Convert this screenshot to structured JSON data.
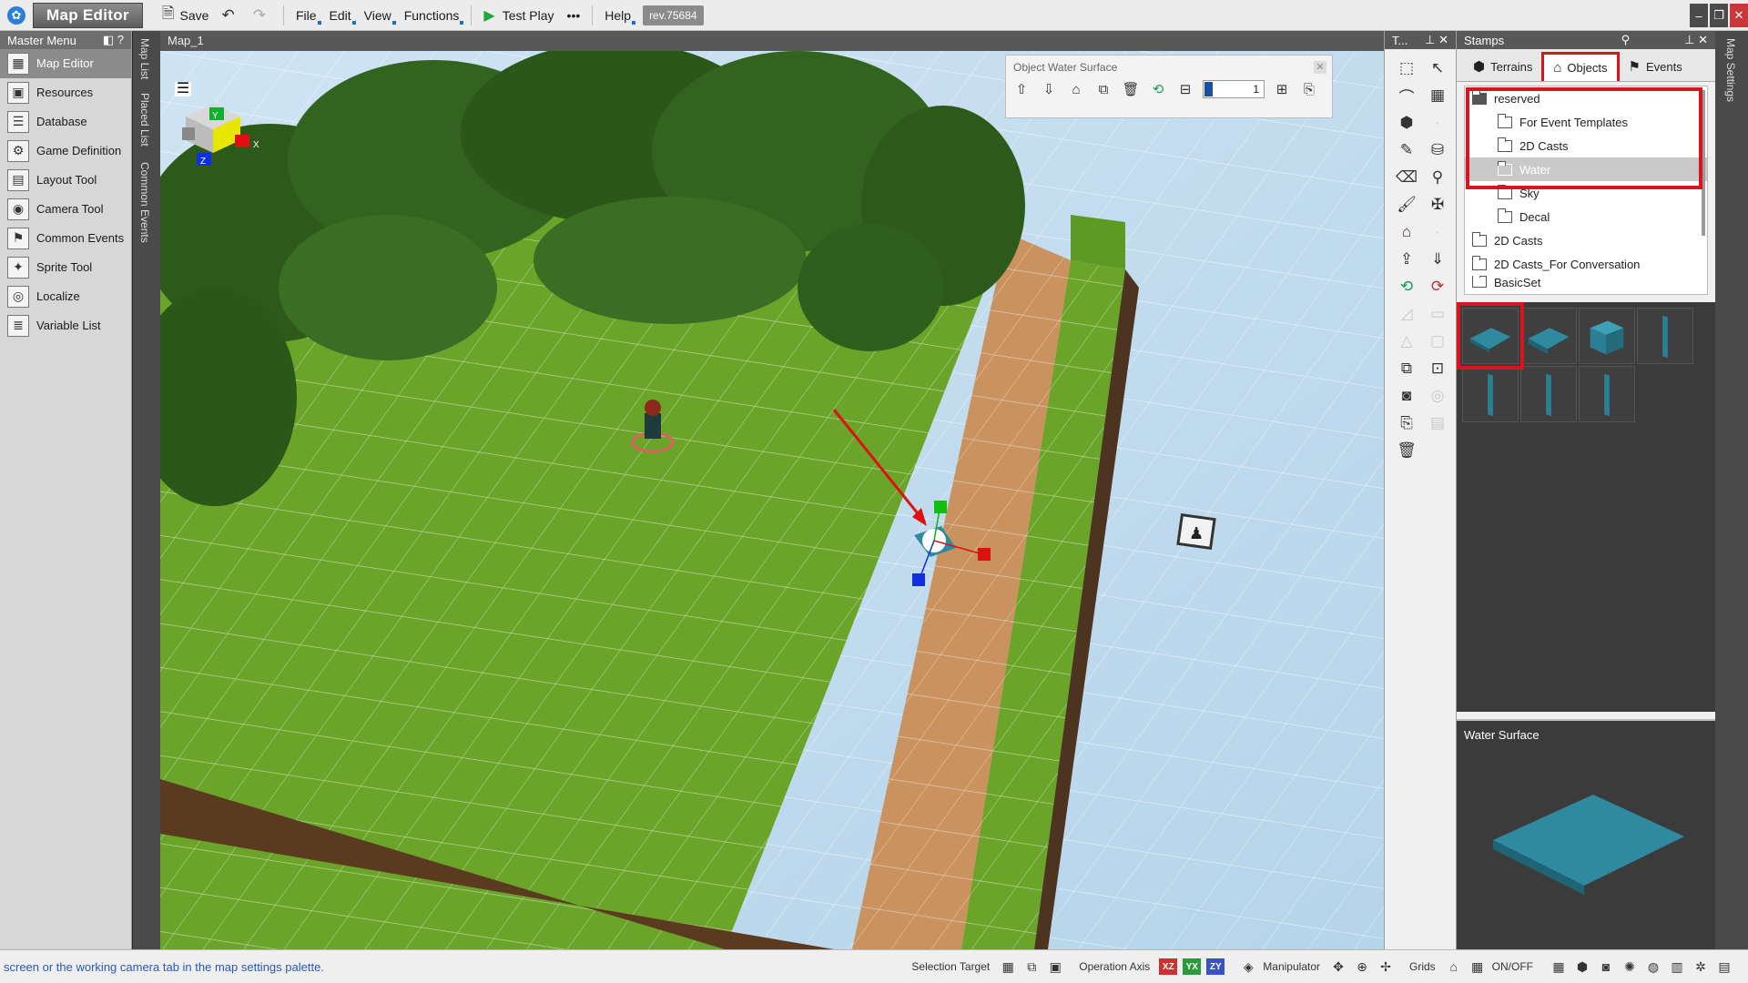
{
  "titlebar": {
    "app_title": "Map Editor",
    "save_label": "Save",
    "menus": [
      "File",
      "Edit",
      "View",
      "Functions"
    ],
    "test_play": "Test Play",
    "more": "•••",
    "help": "Help",
    "revision": "rev.75684"
  },
  "master_menu": {
    "title": "Master Menu",
    "items": [
      "Map Editor",
      "Resources",
      "Database",
      "Game Definition",
      "Layout Tool",
      "Camera Tool",
      "Common Events",
      "Sprite Tool",
      "Localize",
      "Variable List"
    ],
    "selected_index": 0
  },
  "side_tabs": {
    "map_list": "Map List",
    "placed_list": "Placed List",
    "common_events": "Common Events"
  },
  "viewport": {
    "tab": "Map_1",
    "object_panel_title": "Object Water Surface",
    "object_panel_value": "1",
    "axis_labels": {
      "x": "X",
      "y": "Y",
      "z": "Z"
    }
  },
  "tools_panel": {
    "title": "T..."
  },
  "stamps": {
    "title": "Stamps",
    "tabs": [
      "Terrains",
      "Objects",
      "Events"
    ],
    "active_tab": 1,
    "tree": [
      {
        "label": "reserved",
        "level": 0,
        "open": true
      },
      {
        "label": "For Event Templates",
        "level": 1
      },
      {
        "label": "2D Casts",
        "level": 1
      },
      {
        "label": "Water",
        "level": 1,
        "selected": true
      },
      {
        "label": "Sky",
        "level": 1
      },
      {
        "label": "Decal",
        "level": 1
      },
      {
        "label": "2D Casts",
        "level": 0
      },
      {
        "label": "2D Casts_For Conversation",
        "level": 0
      },
      {
        "label": "BasicSet",
        "level": 0
      }
    ],
    "preview_title": "Water Surface"
  },
  "right_edge": {
    "map_settings": "Map Settings"
  },
  "status": {
    "message": "screen or the working camera tab in the map settings palette.",
    "selection_target": "Selection Target",
    "operation_axis": "Operation Axis",
    "axes": [
      "XZ",
      "YX",
      "ZY"
    ],
    "manipulator": "Manipulator",
    "grids": "Grids",
    "onoff": "ON/OFF"
  },
  "colors": {
    "accent_red": "#d8141e",
    "grass": "#6aa52a",
    "path": "#c9925e",
    "water": "#2f8aa0"
  }
}
